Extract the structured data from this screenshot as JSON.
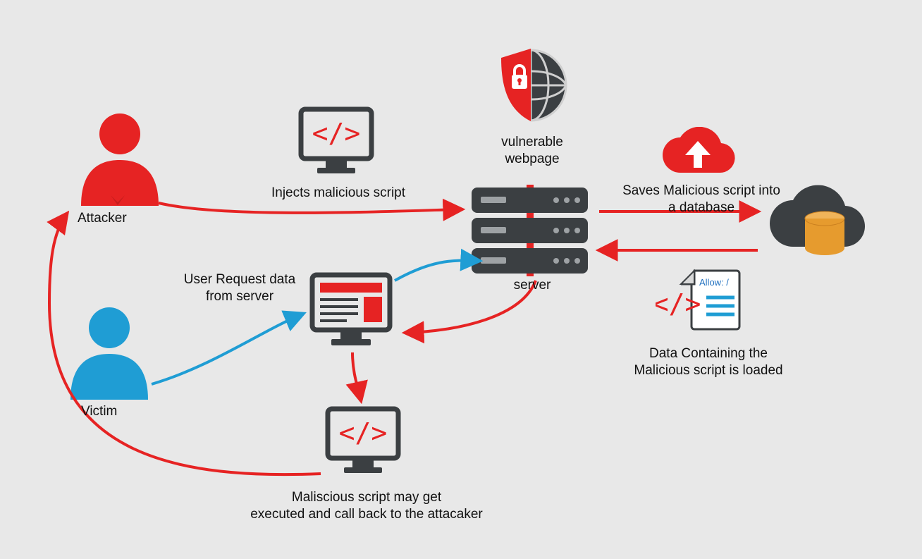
{
  "colors": {
    "red": "#e62323",
    "blue": "#1f9dd4",
    "darkgray": "#3b3f42",
    "orange": "#e69b2e",
    "bg": "#e8e8e8"
  },
  "labels": {
    "attacker": "Attacker",
    "victim": "Victim",
    "injects": "Injects malicious script",
    "vulnerable_webpage": "vulnerable\nwebpage",
    "server": "server",
    "saves_db": "Saves Malicious script into\na database",
    "user_request": "User Request data\nfrom server",
    "malicious_exec": "Maliscious script may get\nexecuted and call back to the attacaker",
    "data_loaded": "Data Containing the\nMalicious script is loaded",
    "allow_slash": "Allow: /"
  },
  "nodes": {
    "attacker": {
      "type": "person",
      "color": "red"
    },
    "victim": {
      "type": "person",
      "color": "blue"
    },
    "script_terminal_top": {
      "type": "monitor-code"
    },
    "script_terminal_bottom": {
      "type": "monitor-code"
    },
    "victim_browser": {
      "type": "monitor-page"
    },
    "shield_globe": {
      "type": "shield-globe"
    },
    "server": {
      "type": "server-stack"
    },
    "cloud_upload": {
      "type": "cloud-up"
    },
    "cloud_db": {
      "type": "cloud-db"
    },
    "allow_file": {
      "type": "code-file"
    }
  },
  "arrows": [
    {
      "from": "attacker",
      "to": "server",
      "color": "red",
      "label_ref": "injects"
    },
    {
      "from": "server",
      "to": "cloud_db",
      "color": "red",
      "label_ref": "saves_db"
    },
    {
      "from": "cloud_db",
      "to": "server",
      "color": "red",
      "label_ref": "data_loaded"
    },
    {
      "from": "victim",
      "to": "victim_browser",
      "color": "blue",
      "label_ref": "user_request"
    },
    {
      "from": "victim_browser",
      "to": "server",
      "color": "blue"
    },
    {
      "from": "server",
      "to": "victim_browser",
      "color": "red"
    },
    {
      "from": "victim_browser",
      "to": "script_terminal_bottom",
      "color": "red"
    },
    {
      "from": "script_terminal_bottom",
      "to": "attacker",
      "color": "red",
      "label_ref": "malicious_exec"
    }
  ]
}
